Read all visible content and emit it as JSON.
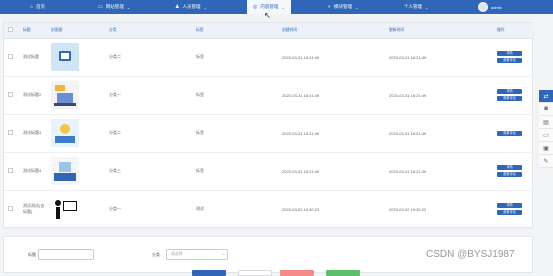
{
  "nav": [
    {
      "icon": "home-icon",
      "glyph": "⌂",
      "label": "首页",
      "caret": false
    },
    {
      "icon": "site-manage-icon",
      "glyph": "▭",
      "label": "网站管理",
      "caret": true
    },
    {
      "icon": "user-icon",
      "glyph": "♟",
      "label": "人员管理",
      "caret": true
    },
    {
      "icon": "content-icon",
      "glyph": "◎",
      "label": "内容管理",
      "caret": true
    },
    {
      "icon": "module-icon",
      "glyph": "◐",
      "label": "模块管理",
      "caret": true
    },
    {
      "icon": "personal-icon",
      "glyph": "",
      "label": "个人管理",
      "caret": true
    }
  ],
  "user": {
    "name": "admin"
  },
  "table": {
    "headers": [
      "标题",
      "封面图",
      "分类",
      "标签",
      "创建时间",
      "更新时间",
      "操作"
    ],
    "rows": [
      {
        "title": "测试标题",
        "category": "分类二",
        "tag": "标签",
        "created": "2023-03-31 18:21:49",
        "updated": "2023-03-31 18:21:49",
        "actions": [
          "详情",
          "查看评论"
        ]
      },
      {
        "title": "测试标题2",
        "category": "分类一",
        "tag": "标签",
        "created": "2023-03-31 18:21:49",
        "updated": "2023-03-31 18:21:49",
        "actions": [
          "详情",
          "查看评论"
        ]
      },
      {
        "title": "测试标题3",
        "category": "分类二",
        "tag": "标签",
        "created": "2023-03-31 18:21:49",
        "updated": "2023-03-31 18:21:49",
        "actions": [
          "查看评论"
        ]
      },
      {
        "title": "测试标题4",
        "category": "分类三",
        "tag": "标签",
        "created": "2023-03-31 18:21:49",
        "updated": "2023-03-31 18:21:49",
        "actions": [
          "详情",
          "查看评论"
        ]
      },
      {
        "title": "测试测试(去标题)",
        "category": "分类一",
        "tag": "测试",
        "created": "2023-03-02 19:30:23",
        "updated": "2023-03-02 19:30:23",
        "actions": [
          "详情",
          "查看评论"
        ]
      }
    ]
  },
  "filter": {
    "title_label": "标题",
    "category_label": "分类",
    "category_placeholder": "请选择"
  },
  "side_tools": [
    "share-icon",
    "camera-icon",
    "layers-icon",
    "window-icon",
    "message-icon",
    "pen-icon"
  ],
  "watermark": "CSDN @BYSJ1987"
}
